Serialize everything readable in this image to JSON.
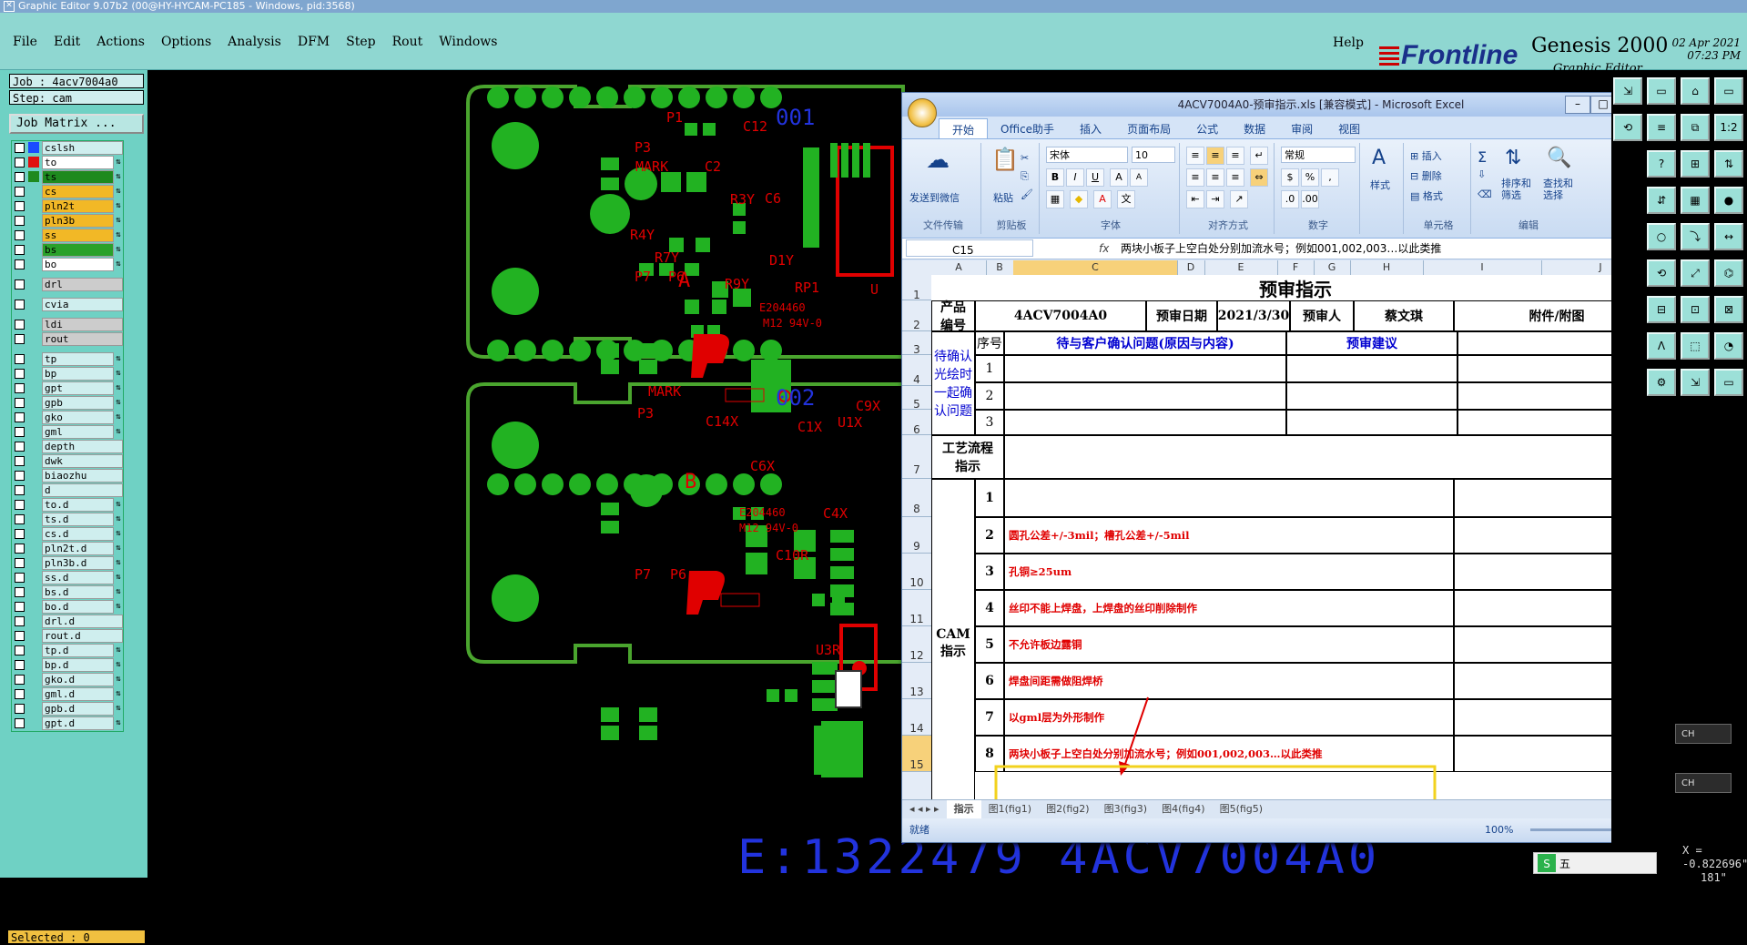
{
  "window_title": "Graphic Editor 9.07b2 (00@HY-HYCAM-PC185 - Windows, pid:3568)",
  "menu": [
    "File",
    "Edit",
    "Actions",
    "Options",
    "Analysis",
    "DFM",
    "Step",
    "Rout",
    "Windows"
  ],
  "help": "Help",
  "brand": {
    "logo": "Frontline",
    "product": "Genesis 2000",
    "subtitle": "Graphic Editor",
    "date": "02 Apr 2021",
    "time": "07:23 PM"
  },
  "job_label": "Job : 4acv7004a0",
  "step_label": "Step: cam",
  "job_matrix": "Job Matrix ...",
  "layers": [
    {
      "name": "cslsh",
      "color": "#1a4bff",
      "bg": "#cfeeee",
      "arrow": ""
    },
    {
      "name": "to",
      "color": "#e01010",
      "bg": "#ffffff",
      "arrow": "⇅"
    },
    {
      "name": "ts",
      "color": "#1e8a1e",
      "bg": "#1e8a1e",
      "arrow": "⇅"
    },
    {
      "name": "cs",
      "color": "",
      "bg": "#f2b826",
      "arrow": "⇅"
    },
    {
      "name": "pln2t",
      "color": "",
      "bg": "#f2b826",
      "arrow": "⇅"
    },
    {
      "name": "pln3b",
      "color": "",
      "bg": "#f2b826",
      "arrow": "⇅"
    },
    {
      "name": "ss",
      "color": "",
      "bg": "#f2b826",
      "arrow": "⇅"
    },
    {
      "name": "bs",
      "color": "",
      "bg": "#2aa12a",
      "arrow": "⇅"
    },
    {
      "name": "bo",
      "color": "",
      "bg": "#ffffff",
      "arrow": "⇅"
    },
    {
      "name": "drl",
      "color": "",
      "bg": "#cccccc",
      "arrow": ""
    },
    {
      "name": "cvia",
      "color": "",
      "bg": "#cfeeee",
      "arrow": ""
    },
    {
      "name": "ldi",
      "color": "",
      "bg": "#cccccc",
      "arrow": ""
    },
    {
      "name": "rout",
      "color": "",
      "bg": "#cccccc",
      "arrow": ""
    },
    {
      "name": "tp",
      "color": "",
      "bg": "#cfeeee",
      "arrow": "⇅"
    },
    {
      "name": "bp",
      "color": "",
      "bg": "#cfeeee",
      "arrow": "⇅"
    },
    {
      "name": "gpt",
      "color": "",
      "bg": "#cfeeee",
      "arrow": "⇅"
    },
    {
      "name": "gpb",
      "color": "",
      "bg": "#cfeeee",
      "arrow": "⇅"
    },
    {
      "name": "gko",
      "color": "",
      "bg": "#cfeeee",
      "arrow": "⇅"
    },
    {
      "name": "gml",
      "color": "",
      "bg": "#cfeeee",
      "arrow": "⇅"
    },
    {
      "name": "depth",
      "color": "",
      "bg": "#cfeeee",
      "arrow": ""
    },
    {
      "name": "dwk",
      "color": "",
      "bg": "#cfeeee",
      "arrow": ""
    },
    {
      "name": "biaozhu",
      "color": "",
      "bg": "#cfeeee",
      "arrow": ""
    },
    {
      "name": "d",
      "color": "",
      "bg": "#cfeeee",
      "arrow": ""
    },
    {
      "name": "to.d",
      "color": "",
      "bg": "#cfeeee",
      "arrow": "⇅"
    },
    {
      "name": "ts.d",
      "color": "",
      "bg": "#cfeeee",
      "arrow": "⇅"
    },
    {
      "name": "cs.d",
      "color": "",
      "bg": "#cfeeee",
      "arrow": "⇅"
    },
    {
      "name": "pln2t.d",
      "color": "",
      "bg": "#cfeeee",
      "arrow": "⇅"
    },
    {
      "name": "pln3b.d",
      "color": "",
      "bg": "#cfeeee",
      "arrow": "⇅"
    },
    {
      "name": "ss.d",
      "color": "",
      "bg": "#cfeeee",
      "arrow": "⇅"
    },
    {
      "name": "bs.d",
      "color": "",
      "bg": "#cfeeee",
      "arrow": "⇅"
    },
    {
      "name": "bo.d",
      "color": "",
      "bg": "#cfeeee",
      "arrow": "⇅"
    },
    {
      "name": "drl.d",
      "color": "",
      "bg": "#cfeeee",
      "arrow": ""
    },
    {
      "name": "rout.d",
      "color": "",
      "bg": "#cfeeee",
      "arrow": ""
    },
    {
      "name": "tp.d",
      "color": "",
      "bg": "#cfeeee",
      "arrow": "⇅"
    },
    {
      "name": "bp.d",
      "color": "",
      "bg": "#cfeeee",
      "arrow": "⇅"
    },
    {
      "name": "gko.d",
      "color": "",
      "bg": "#cfeeee",
      "arrow": "⇅"
    },
    {
      "name": "gml.d",
      "color": "",
      "bg": "#cfeeee",
      "arrow": "⇅"
    },
    {
      "name": "gpb.d",
      "color": "",
      "bg": "#cfeeee",
      "arrow": "⇅"
    },
    {
      "name": "gpt.d",
      "color": "",
      "bg": "#cfeeee",
      "arrow": "⇅"
    }
  ],
  "selected_label": "Selected : 0",
  "pcb": {
    "board1": {
      "number": "001",
      "labels": [
        "P1",
        "P3",
        "MARK",
        "C12",
        "C2",
        "R3Y",
        "C6",
        "R4Y",
        "R7Y",
        "D1Y",
        "R9Y",
        "P7",
        "P6",
        "A",
        "RP1",
        "U",
        "E204460",
        "M12 94V-0"
      ]
    },
    "board2": {
      "number": "002",
      "labels": [
        "MARK",
        "P3",
        "C14X",
        "C1X",
        "U1X",
        "C9X",
        "C6X",
        "B",
        "E204460",
        "M12 94V-0",
        "C4X",
        "C10R",
        "P7",
        "P6",
        "U3R"
      ]
    },
    "bottom_text": "E:1322479 4ACV7004A0"
  },
  "excel": {
    "title": "4ACV7004A0-预审指示.xls [兼容模式] - Microsoft Excel",
    "tabs": [
      "开始",
      "Office助手",
      "插入",
      "页面布局",
      "公式",
      "数据",
      "审阅",
      "视图"
    ],
    "ribbon": {
      "send_weixin": "发送到微信",
      "group_file": "文件传输",
      "paste": "粘贴",
      "group_clipboard": "剪贴板",
      "font_name": "宋体",
      "font_size": "10",
      "group_font": "字体",
      "group_align": "对齐方式",
      "number_format": "常规",
      "group_number": "数字",
      "styles": "样式",
      "insert": "插入",
      "delete": "删除",
      "format": "格式",
      "group_cells": "单元格",
      "sort": "排序和\n筛选",
      "find": "查找和\n选择",
      "group_edit": "编辑"
    },
    "name_box": "C15",
    "formula": "两块小板子上空白处分别加流水号；例如001,002,003…以此类推",
    "columns": [
      "A",
      "B",
      "C",
      "D",
      "E",
      "F",
      "G",
      "H",
      "I",
      "J"
    ],
    "rows": [
      "1",
      "2",
      "3",
      "4",
      "5",
      "6",
      "7",
      "8",
      "9",
      "10",
      "11",
      "12",
      "13",
      "14",
      "15"
    ],
    "sheet": {
      "title": "预审指示",
      "product_label": "产品\n编号",
      "product_no": "4ACV7004A0",
      "review_date_label": "预审日期",
      "review_date": "2021/3/30",
      "reviewer_label": "预审人",
      "reviewer": "蔡文琪",
      "attachment_label": "附件/附图",
      "seq_label": "序号",
      "confirm_header": "待与客户确认问题(原因与内容)",
      "suggest_header": "预审建议",
      "confirm_group": "待确认\n光绘时\n一起确\n认问题",
      "confirm_rows": [
        "1",
        "2",
        "3"
      ],
      "process_label": "工艺流程\n指示",
      "cam_label": "CAM\n指示",
      "cam_rows": [
        {
          "no": "1",
          "text": ""
        },
        {
          "no": "2",
          "text": "圆孔公差+/-3mil；槽孔公差+/-5mil"
        },
        {
          "no": "3",
          "text": "孔铜≥25um"
        },
        {
          "no": "4",
          "text": "丝印不能上焊盘，上焊盘的丝印削除制作"
        },
        {
          "no": "5",
          "text": "不允许板边露铜"
        },
        {
          "no": "6",
          "text": "焊盘间距需做阻焊桥"
        },
        {
          "no": "7",
          "text": "以gml层为外形制作"
        },
        {
          "no": "8",
          "text": "两块小板子上空白处分别加流水号；例如001,002,003…以此类推"
        }
      ]
    },
    "sheet_tabs": [
      "指示",
      "图1(fig1)",
      "图2(fig2)",
      "图3(fig3)",
      "图4(fig4)",
      "图5(fig5)"
    ],
    "status_ready": "就绪",
    "zoom": "100%"
  },
  "side": {
    "ch1": "CH",
    "ch2": "CH"
  },
  "coords": {
    "x": "X = -0.822696\"",
    "y": "181\""
  },
  "ime": "五"
}
